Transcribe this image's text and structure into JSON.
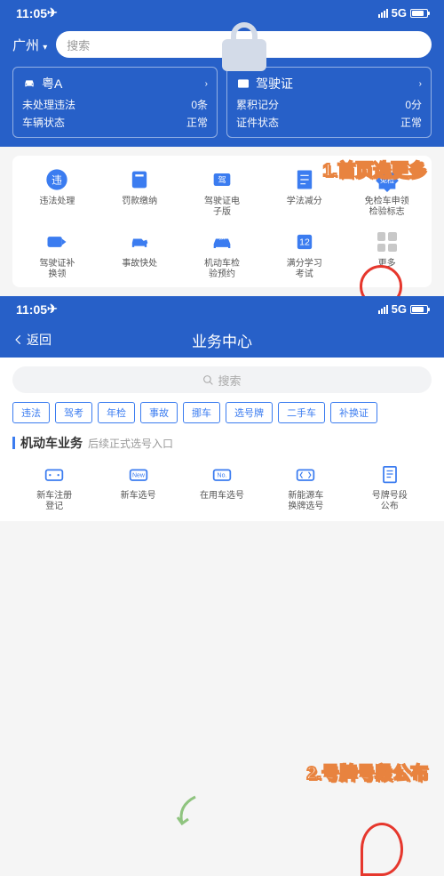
{
  "status": {
    "time": "11:05",
    "net": "5G"
  },
  "top": {
    "city": "广州",
    "search": "搜索",
    "cardA": {
      "title": "粤A",
      "r1l": "未处理违法",
      "r1v": "0条",
      "r2l": "车辆状态",
      "r2v": "正常"
    },
    "cardB": {
      "title": "驾驶证",
      "r1l": "累积记分",
      "r1v": "0分",
      "r2l": "证件状态",
      "r2v": "正常"
    }
  },
  "grid1": [
    {
      "l": "违法处理"
    },
    {
      "l": "罚款缴纳"
    },
    {
      "l": "驾驶证电\n子版"
    },
    {
      "l": "学法减分"
    },
    {
      "l": "免检车申领\n检验标志"
    },
    {
      "l": "驾驶证补\n换领"
    },
    {
      "l": "事故快处"
    },
    {
      "l": "机动车检\n验预约"
    },
    {
      "l": "满分学习\n考试"
    },
    {
      "l": "更多"
    }
  ],
  "anno1": "1.首页选更多",
  "s2": {
    "back": "返回",
    "title": "业务中心",
    "search": "搜索",
    "chips": [
      "违法",
      "驾考",
      "年检",
      "事故",
      "挪车",
      "选号牌",
      "二手车",
      "补换证"
    ],
    "section": "机动车业务",
    "hint": "后续正式选号入口"
  },
  "grid2": [
    {
      "l": "新车注册\n登记"
    },
    {
      "l": "新车选号"
    },
    {
      "l": "在用车选号"
    },
    {
      "l": "新能源车\n换牌选号"
    },
    {
      "l": "号牌号段\n公布"
    }
  ],
  "anno2": "2.号牌号段公布"
}
